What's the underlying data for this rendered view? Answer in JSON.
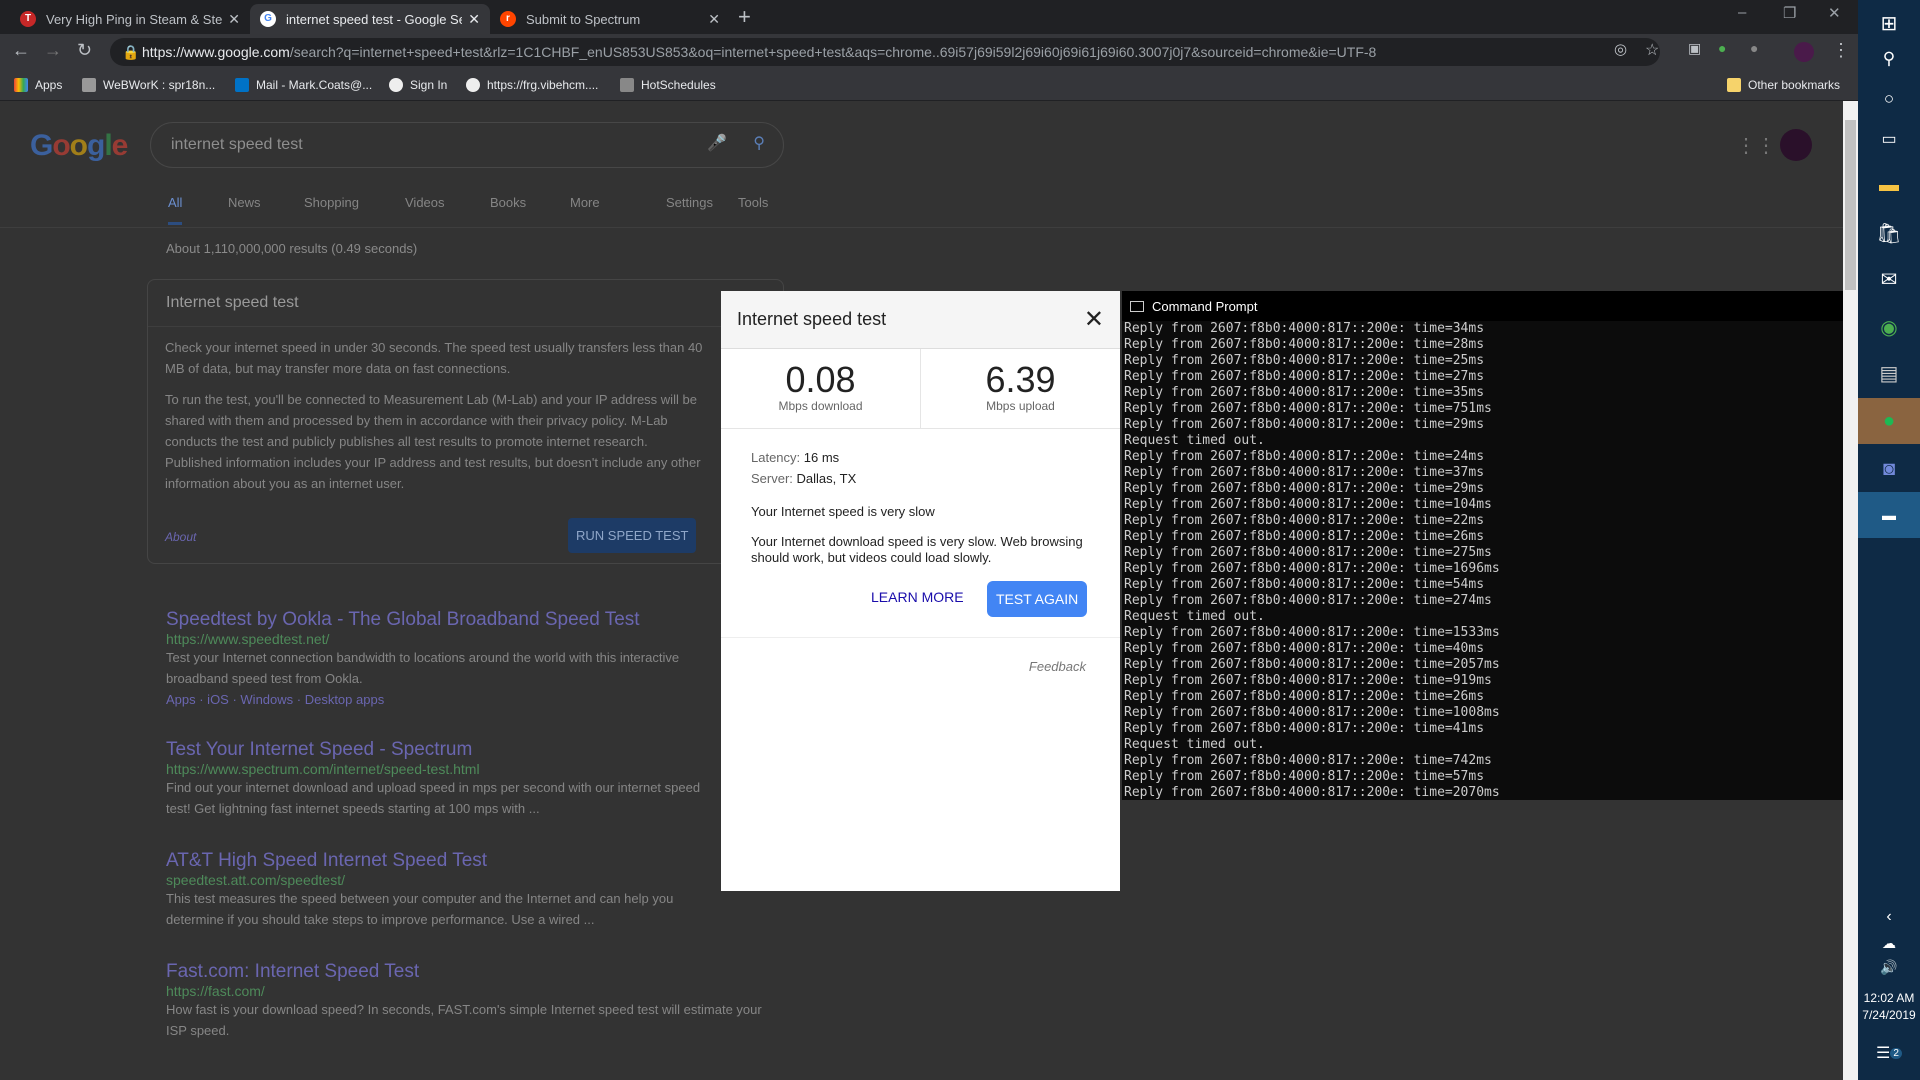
{
  "browser": {
    "tabs": [
      {
        "title": "Very High Ping in Steam & Steam",
        "icon": "steam-forum-icon",
        "color": "#c62828"
      },
      {
        "title": "internet speed test - Google Sear",
        "icon": "google-icon",
        "color": "#4285f4"
      },
      {
        "title": "Submit to Spectrum",
        "icon": "reddit-icon",
        "color": "#ff4500"
      }
    ],
    "url_host": "https://www.google.com",
    "url_rest": "/search?q=internet+speed+test&rlz=1C1CHBF_enUS853US853&oq=internet+speed+test&aqs=chrome..69i57j69i59l2j69i60j69i61j69i60.3007j0j7&sourceid=chrome&ie=UTF-8",
    "bookmarks": [
      "Apps",
      "WeBWorK : spr18n...",
      "Mail - Mark.Coats@...",
      "Sign In",
      "https://frg.vibehcm....",
      "HotSchedules"
    ],
    "other_bookmarks": "Other bookmarks"
  },
  "google": {
    "logo": "Google",
    "query": "internet speed test",
    "tabs": [
      "All",
      "News",
      "Shopping",
      "Videos",
      "Books",
      "More"
    ],
    "settings": "Settings",
    "tools": "Tools",
    "result_stats": "About 1,110,000,000 results (0.49 seconds)",
    "card": {
      "title": "Internet speed test",
      "p1": "Check your internet speed in under 30 seconds. The speed test usually transfers less than 40 MB of data, but may transfer more data on fast connections.",
      "p2": "To run the test, you'll be connected to Measurement Lab (M-Lab) and your IP address will be shared with them and processed by them in accordance with their privacy policy. M-Lab conducts the test and publicly publishes all test results to promote internet research. Published information includes your IP address and test results, but doesn't include any other information about you as an internet user.",
      "about": "About",
      "run": "RUN SPEED TEST"
    },
    "results": [
      {
        "title": "Speedtest by Ookla - The Global Broadband Speed Test",
        "url": "https://www.speedtest.net/",
        "snippet": "Test your Internet connection bandwidth to locations around the world with this interactive broadband speed test from Ookla.",
        "links": "Apps · iOS · Windows · Desktop apps"
      },
      {
        "title": "Test Your Internet Speed - Spectrum",
        "url": "https://www.spectrum.com/internet/speed-test.html",
        "snippet": "Find out your internet download and upload speed in mps per second with our internet speed test! Get lightning fast internet speeds starting at 100 mps with ..."
      },
      {
        "title": "AT&T High Speed Internet Speed Test",
        "url": "speedtest.att.com/speedtest/",
        "snippet": "This test measures the speed between your computer and the Internet and can help you determine if you should take steps to improve performance. Use a wired ..."
      },
      {
        "title": "Fast.com: Internet Speed Test",
        "url": "https://fast.com/",
        "snippet": "How fast is your download speed? In seconds, FAST.com's simple Internet speed test will estimate your ISP speed."
      }
    ]
  },
  "dialog": {
    "title": "Internet speed test",
    "download": "0.08",
    "download_label": "Mbps download",
    "upload": "6.39",
    "upload_label": "Mbps upload",
    "latency_label": "Latency:",
    "latency": "16 ms",
    "server_label": "Server:",
    "server": "Dallas, TX",
    "verdict": "Your Internet speed is very slow",
    "detail": "Your Internet download speed is very slow. Web browsing should work, but videos could load slowly.",
    "learn_more": "LEARN MORE",
    "test_again": "TEST AGAIN",
    "feedback": "Feedback"
  },
  "cmd": {
    "title": "Command Prompt",
    "lines": [
      "Reply from 2607:f8b0:4000:817::200e: time=34ms",
      "Reply from 2607:f8b0:4000:817::200e: time=28ms",
      "Reply from 2607:f8b0:4000:817::200e: time=25ms",
      "Reply from 2607:f8b0:4000:817::200e: time=27ms",
      "Reply from 2607:f8b0:4000:817::200e: time=35ms",
      "Reply from 2607:f8b0:4000:817::200e: time=751ms",
      "Reply from 2607:f8b0:4000:817::200e: time=29ms",
      "Request timed out.",
      "Reply from 2607:f8b0:4000:817::200e: time=24ms",
      "Reply from 2607:f8b0:4000:817::200e: time=37ms",
      "Reply from 2607:f8b0:4000:817::200e: time=29ms",
      "Reply from 2607:f8b0:4000:817::200e: time=104ms",
      "Reply from 2607:f8b0:4000:817::200e: time=22ms",
      "Reply from 2607:f8b0:4000:817::200e: time=26ms",
      "Reply from 2607:f8b0:4000:817::200e: time=275ms",
      "Reply from 2607:f8b0:4000:817::200e: time=1696ms",
      "Reply from 2607:f8b0:4000:817::200e: time=54ms",
      "Reply from 2607:f8b0:4000:817::200e: time=274ms",
      "Request timed out.",
      "Reply from 2607:f8b0:4000:817::200e: time=1533ms",
      "Reply from 2607:f8b0:4000:817::200e: time=40ms",
      "Reply from 2607:f8b0:4000:817::200e: time=2057ms",
      "Reply from 2607:f8b0:4000:817::200e: time=919ms",
      "Reply from 2607:f8b0:4000:817::200e: time=26ms",
      "Reply from 2607:f8b0:4000:817::200e: time=1008ms",
      "Reply from 2607:f8b0:4000:817::200e: time=41ms",
      "Request timed out.",
      "Reply from 2607:f8b0:4000:817::200e: time=742ms",
      "Reply from 2607:f8b0:4000:817::200e: time=57ms",
      "Reply from 2607:f8b0:4000:817::200e: time=2070ms"
    ]
  },
  "taskbar": {
    "time": "12:02 AM",
    "date": "7/24/2019",
    "notifications": "2"
  }
}
